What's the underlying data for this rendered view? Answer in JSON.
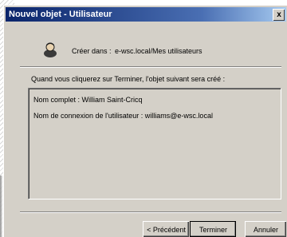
{
  "window": {
    "title": "Nouvel objet - Utilisateur",
    "close_glyph": "x"
  },
  "header": {
    "icon": "user-icon",
    "create_label": "Créer dans :",
    "create_path": "e-wsc.local/Mes utilisateurs"
  },
  "main": {
    "info_text": "Quand vous cliquerez sur Terminer, l'objet suivant sera créé :",
    "summary_lines": [
      "Nom complet : William Saint-Cricq",
      "Nom de connexion de l'utilisateur : williams@e-wsc.local"
    ]
  },
  "buttons": {
    "previous": "< Précédent",
    "finish": "Terminer",
    "cancel": "Annuler"
  }
}
